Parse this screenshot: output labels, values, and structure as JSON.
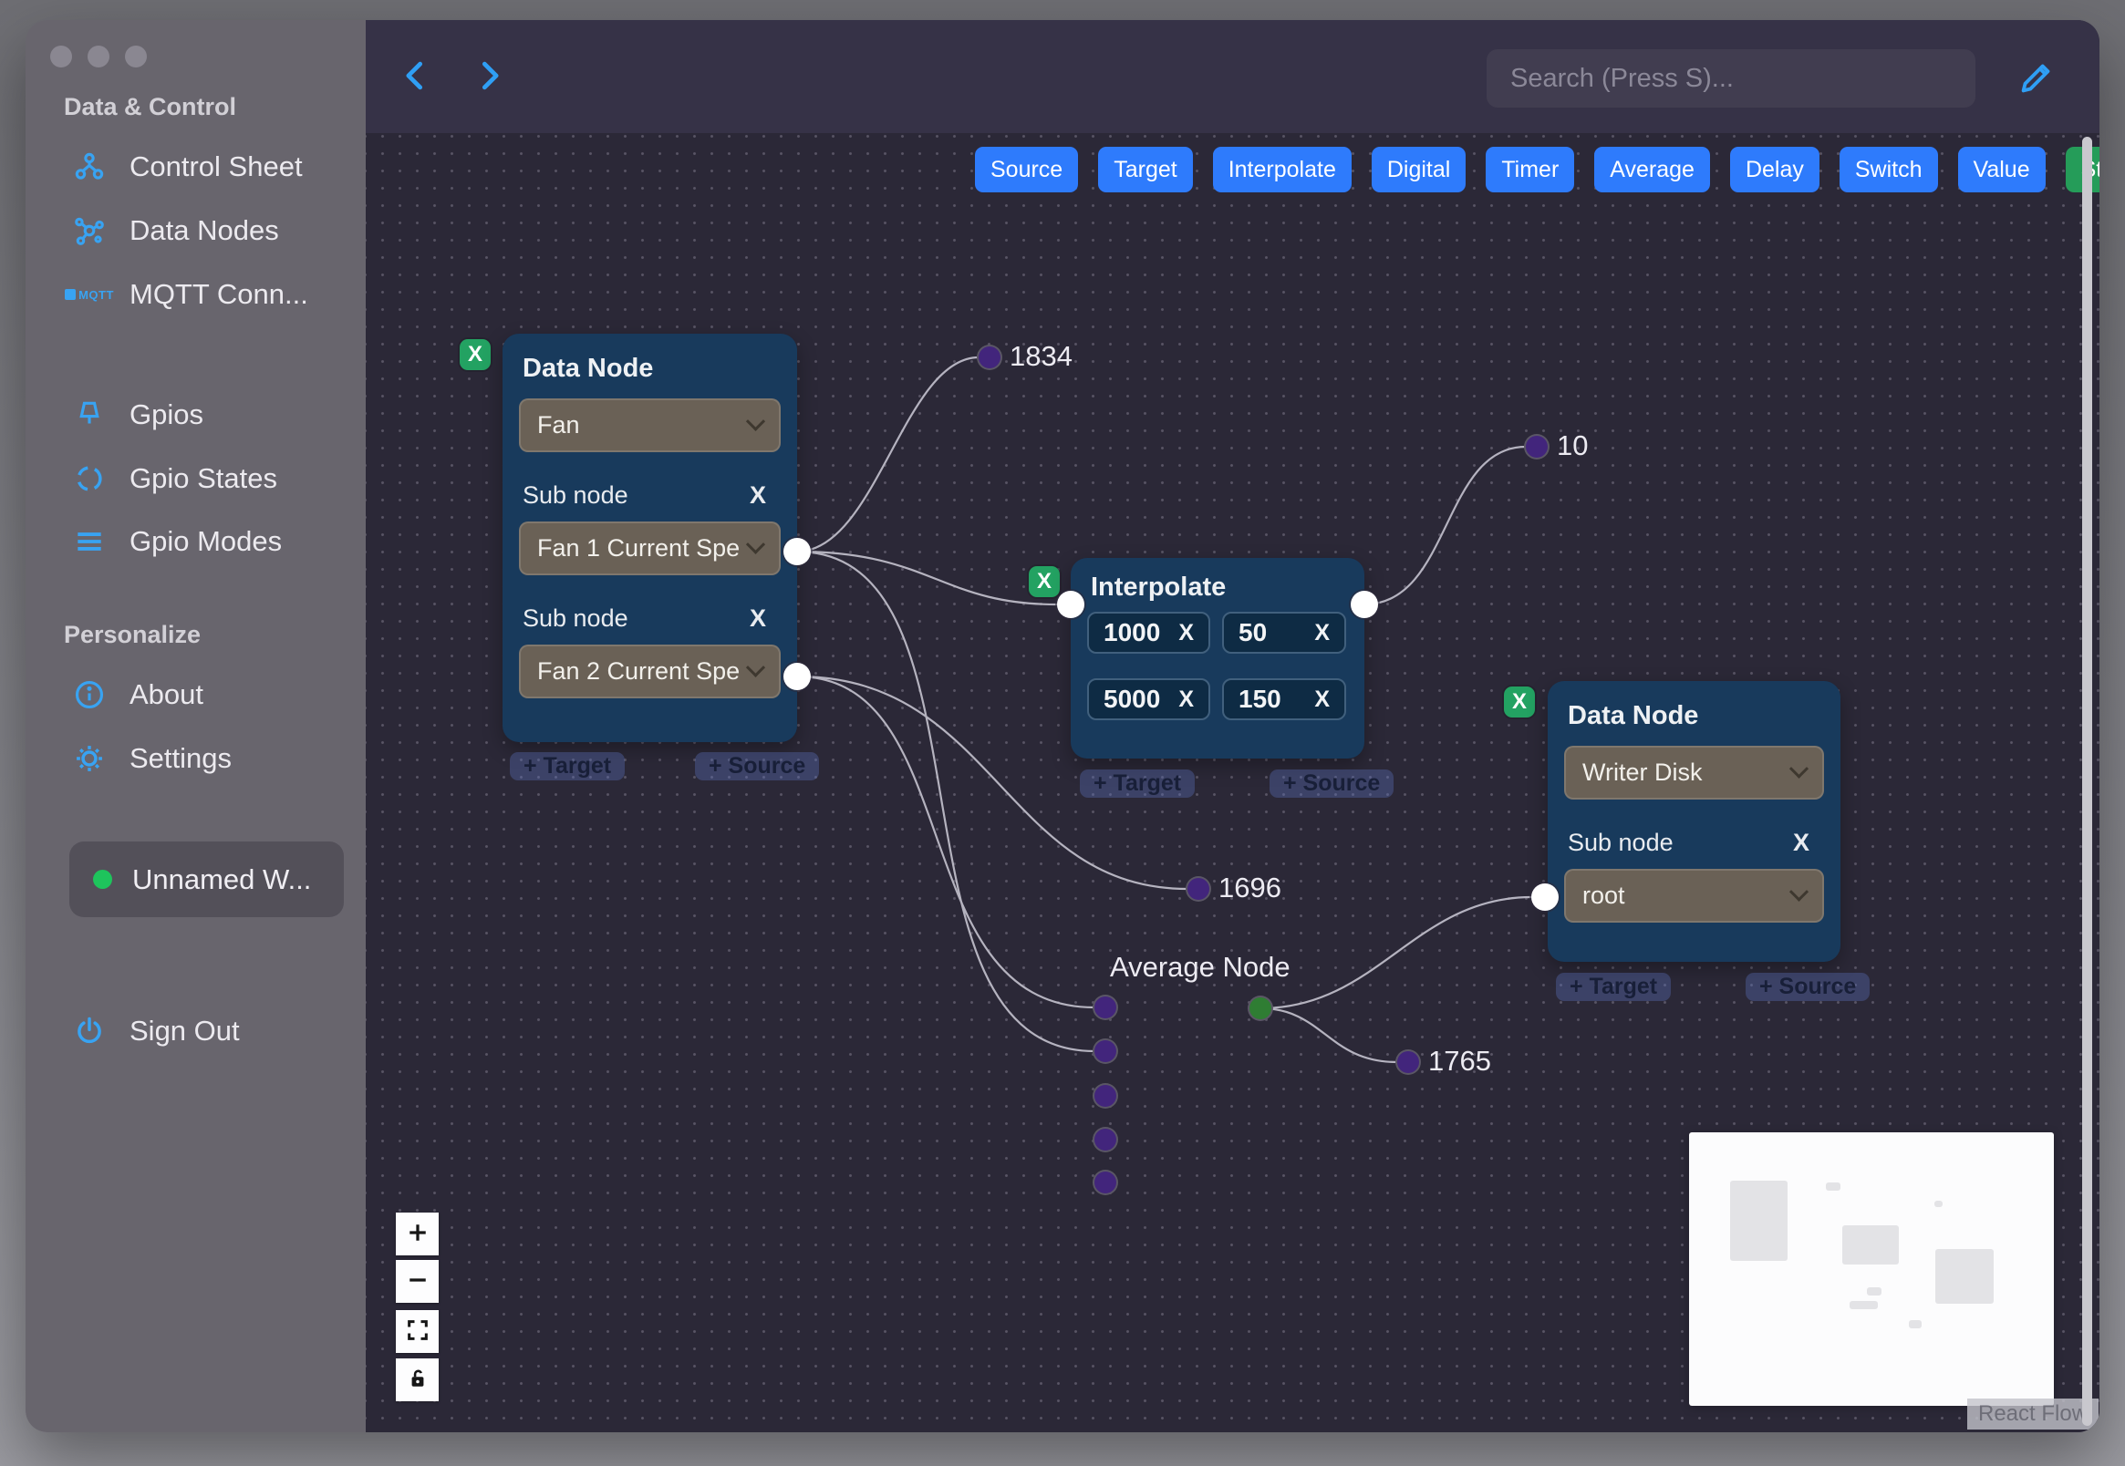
{
  "colors": {
    "accent_blue": "#2e7bfc",
    "stop_green": "#259c59",
    "badge_green": "#23a262",
    "icon_blue": "#38a3f2",
    "node_bg": "#183a5c",
    "canvas_bg": "#2b2837",
    "edge": "#bdbbc7",
    "purple_dot": "#42257c",
    "green_dot": "#2f7d33",
    "workspace_status": "#1ec45c"
  },
  "sidebar": {
    "sections": {
      "data_control": "Data & Control",
      "personalize": "Personalize"
    },
    "items": [
      {
        "label": "Control Sheet",
        "icon": "control-sheet-icon"
      },
      {
        "label": "Data Nodes",
        "icon": "data-nodes-icon"
      },
      {
        "label": "MQTT Conn...",
        "icon": "mqtt-icon",
        "icon_text": "MQTT"
      },
      {
        "label": "Gpios",
        "icon": "pin-icon"
      },
      {
        "label": "Gpio States",
        "icon": "dashed-circle-icon"
      },
      {
        "label": "Gpio Modes",
        "icon": "lines-icon"
      },
      {
        "label": "About",
        "icon": "info-icon"
      },
      {
        "label": "Settings",
        "icon": "gear-icon"
      },
      {
        "label": "Sign Out",
        "icon": "power-icon"
      }
    ],
    "workspace": {
      "label": "Unnamed W..."
    }
  },
  "topbar": {
    "search_placeholder": "Search (Press S)..."
  },
  "toolbar": {
    "buttons": [
      {
        "label": "Source"
      },
      {
        "label": "Target"
      },
      {
        "label": "Interpolate"
      },
      {
        "label": "Digital"
      },
      {
        "label": "Timer"
      },
      {
        "label": "Average"
      },
      {
        "label": "Delay"
      },
      {
        "label": "Switch"
      },
      {
        "label": "Value"
      },
      {
        "label": "Stop",
        "variant": "green"
      }
    ]
  },
  "nodes": {
    "fan": {
      "title": "Data Node",
      "close": "X",
      "type_value": "Fan",
      "sub_nodes": [
        {
          "label": "Sub node",
          "remove": "X",
          "value": "Fan 1 Current Spe"
        },
        {
          "label": "Sub node",
          "remove": "X",
          "value": "Fan 2 Current Spe"
        }
      ],
      "add_target": "+ Target",
      "add_source": "+ Source"
    },
    "interpolate": {
      "title": "Interpolate",
      "close": "X",
      "rows": [
        {
          "input": "1000",
          "remove_input": "X",
          "output": "50",
          "remove_output": "X"
        },
        {
          "input": "5000",
          "remove_input": "X",
          "output": "150",
          "remove_output": "X"
        }
      ],
      "add_target": "+ Target",
      "add_source": "+ Source"
    },
    "writer": {
      "title": "Data Node",
      "close": "X",
      "type_value": "Writer Disk",
      "sub_nodes": [
        {
          "label": "Sub node",
          "remove": "X",
          "value": "root"
        }
      ],
      "add_target": "+ Target",
      "add_source": "+ Source"
    },
    "average": {
      "title": "Average Node"
    }
  },
  "edge_values": {
    "fan1": "1834",
    "interpolate": "10",
    "fan2": "1696",
    "average": "1765"
  },
  "minimap": {
    "attribution": "React Flow"
  }
}
